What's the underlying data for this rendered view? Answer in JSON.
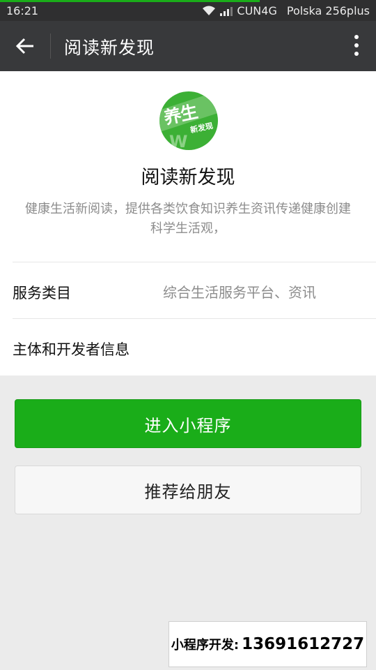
{
  "status_bar": {
    "time": "16:21",
    "carrier": "CUN4G",
    "operator": "Polska 256plus",
    "loading_progress": 0.69
  },
  "nav": {
    "title": "阅读新发现",
    "back_icon": "arrow-left-icon",
    "more_icon": "more-vertical-icon"
  },
  "app": {
    "logo_text": "养生",
    "logo_subtext": "新发现",
    "name": "阅读新发现",
    "description": "健康生活新阅读，提供各类饮食知识养生资讯传递健康创建科学生活观，"
  },
  "info_rows": [
    {
      "label": "服务类目",
      "value": "综合生活服务平台、资讯"
    },
    {
      "label": "主体和开发者信息",
      "value": ""
    }
  ],
  "buttons": {
    "enter": "进入小程序",
    "recommend": "推荐给朋友"
  },
  "watermark": {
    "label": "小程序开发:",
    "phone": "13691612727"
  },
  "colors": {
    "primary": "#1aad19",
    "titlebar": "#38393b"
  }
}
